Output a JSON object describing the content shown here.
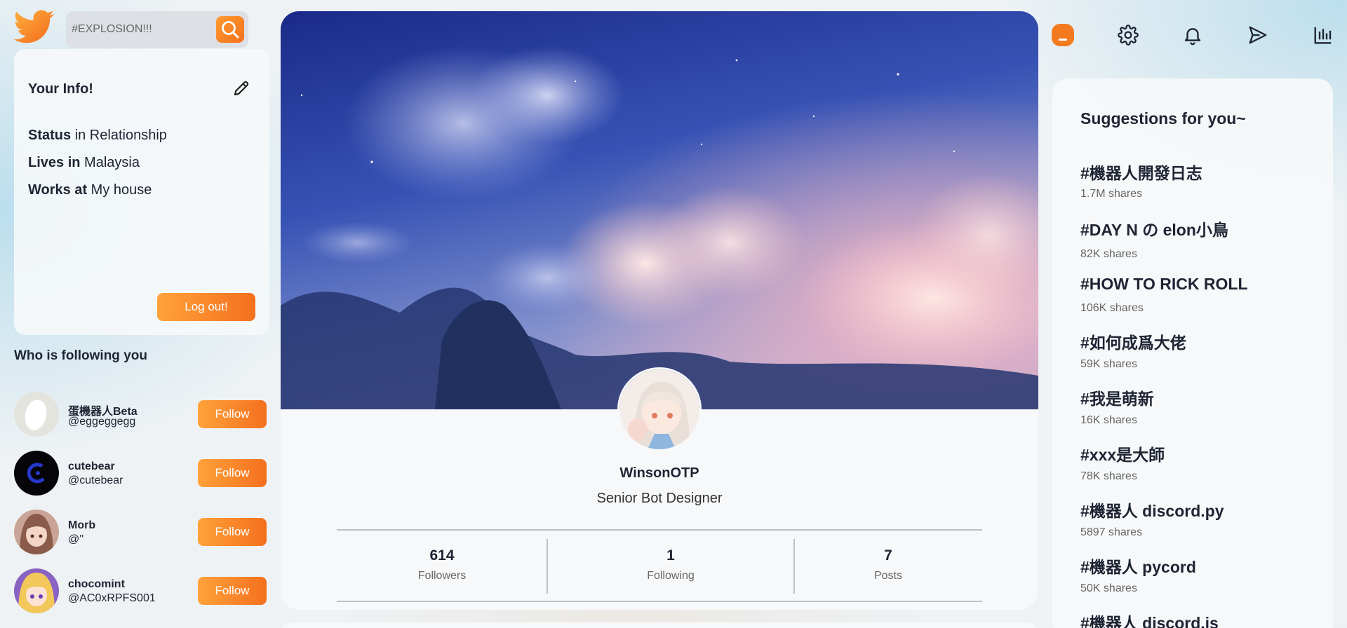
{
  "search": {
    "placeholder": "#EXPLOSION!!!"
  },
  "info": {
    "title": "Your Info!",
    "status_label": "Status",
    "status_value": "in Relationship",
    "lives_label": "Lives in",
    "lives_value": "Malaysia",
    "works_label": "Works at",
    "works_value": "My house",
    "logout_label": "Log out!"
  },
  "followers": {
    "title": "Who is following you",
    "items": [
      {
        "name": "蛋機器人Beta",
        "handle": "@eggeggegg",
        "button": "Follow"
      },
      {
        "name": "cutebear",
        "handle": "@cutebear",
        "button": "Follow"
      },
      {
        "name": "Morb",
        "handle": "@''",
        "button": "Follow"
      },
      {
        "name": "chocomint",
        "handle": "@AC0xRPFS001",
        "button": "Follow"
      }
    ]
  },
  "profile": {
    "name": "WinsonOTP",
    "title": "Senior Bot Designer",
    "stats": [
      {
        "value": "614",
        "label": "Followers"
      },
      {
        "value": "1",
        "label": "Following"
      },
      {
        "value": "7",
        "label": "Posts"
      }
    ]
  },
  "suggestions": {
    "title": "Suggestions for you~",
    "items": [
      {
        "tag": "#機器人開發日志",
        "shares": "1.7M shares"
      },
      {
        "tag": "#DAY N の elon小鳥",
        "shares": "82K shares"
      },
      {
        "tag": "#HOW TO RICK ROLL",
        "shares": "106K shares"
      },
      {
        "tag": "#如何成爲大佬",
        "shares": "59K shares"
      },
      {
        "tag": "#我是萌新",
        "shares": "16K shares"
      },
      {
        "tag": "#xxx是大師",
        "shares": "78K shares"
      },
      {
        "tag": "#機器人 discord.py",
        "shares": "5897 shares"
      },
      {
        "tag": "#機器人 pycord",
        "shares": "50K shares"
      },
      {
        "tag": "#機器人 discord.js",
        "shares": ""
      }
    ]
  },
  "icons": [
    "twitter-bird-icon",
    "search-icon",
    "edit-pencil-icon",
    "avatar-orange-icon",
    "gear-icon",
    "bell-icon",
    "send-icon",
    "bar-chart-icon"
  ],
  "colors": {
    "accent": "#f4701e",
    "accent_light": "#ffa23a",
    "text": "#1f2433"
  }
}
